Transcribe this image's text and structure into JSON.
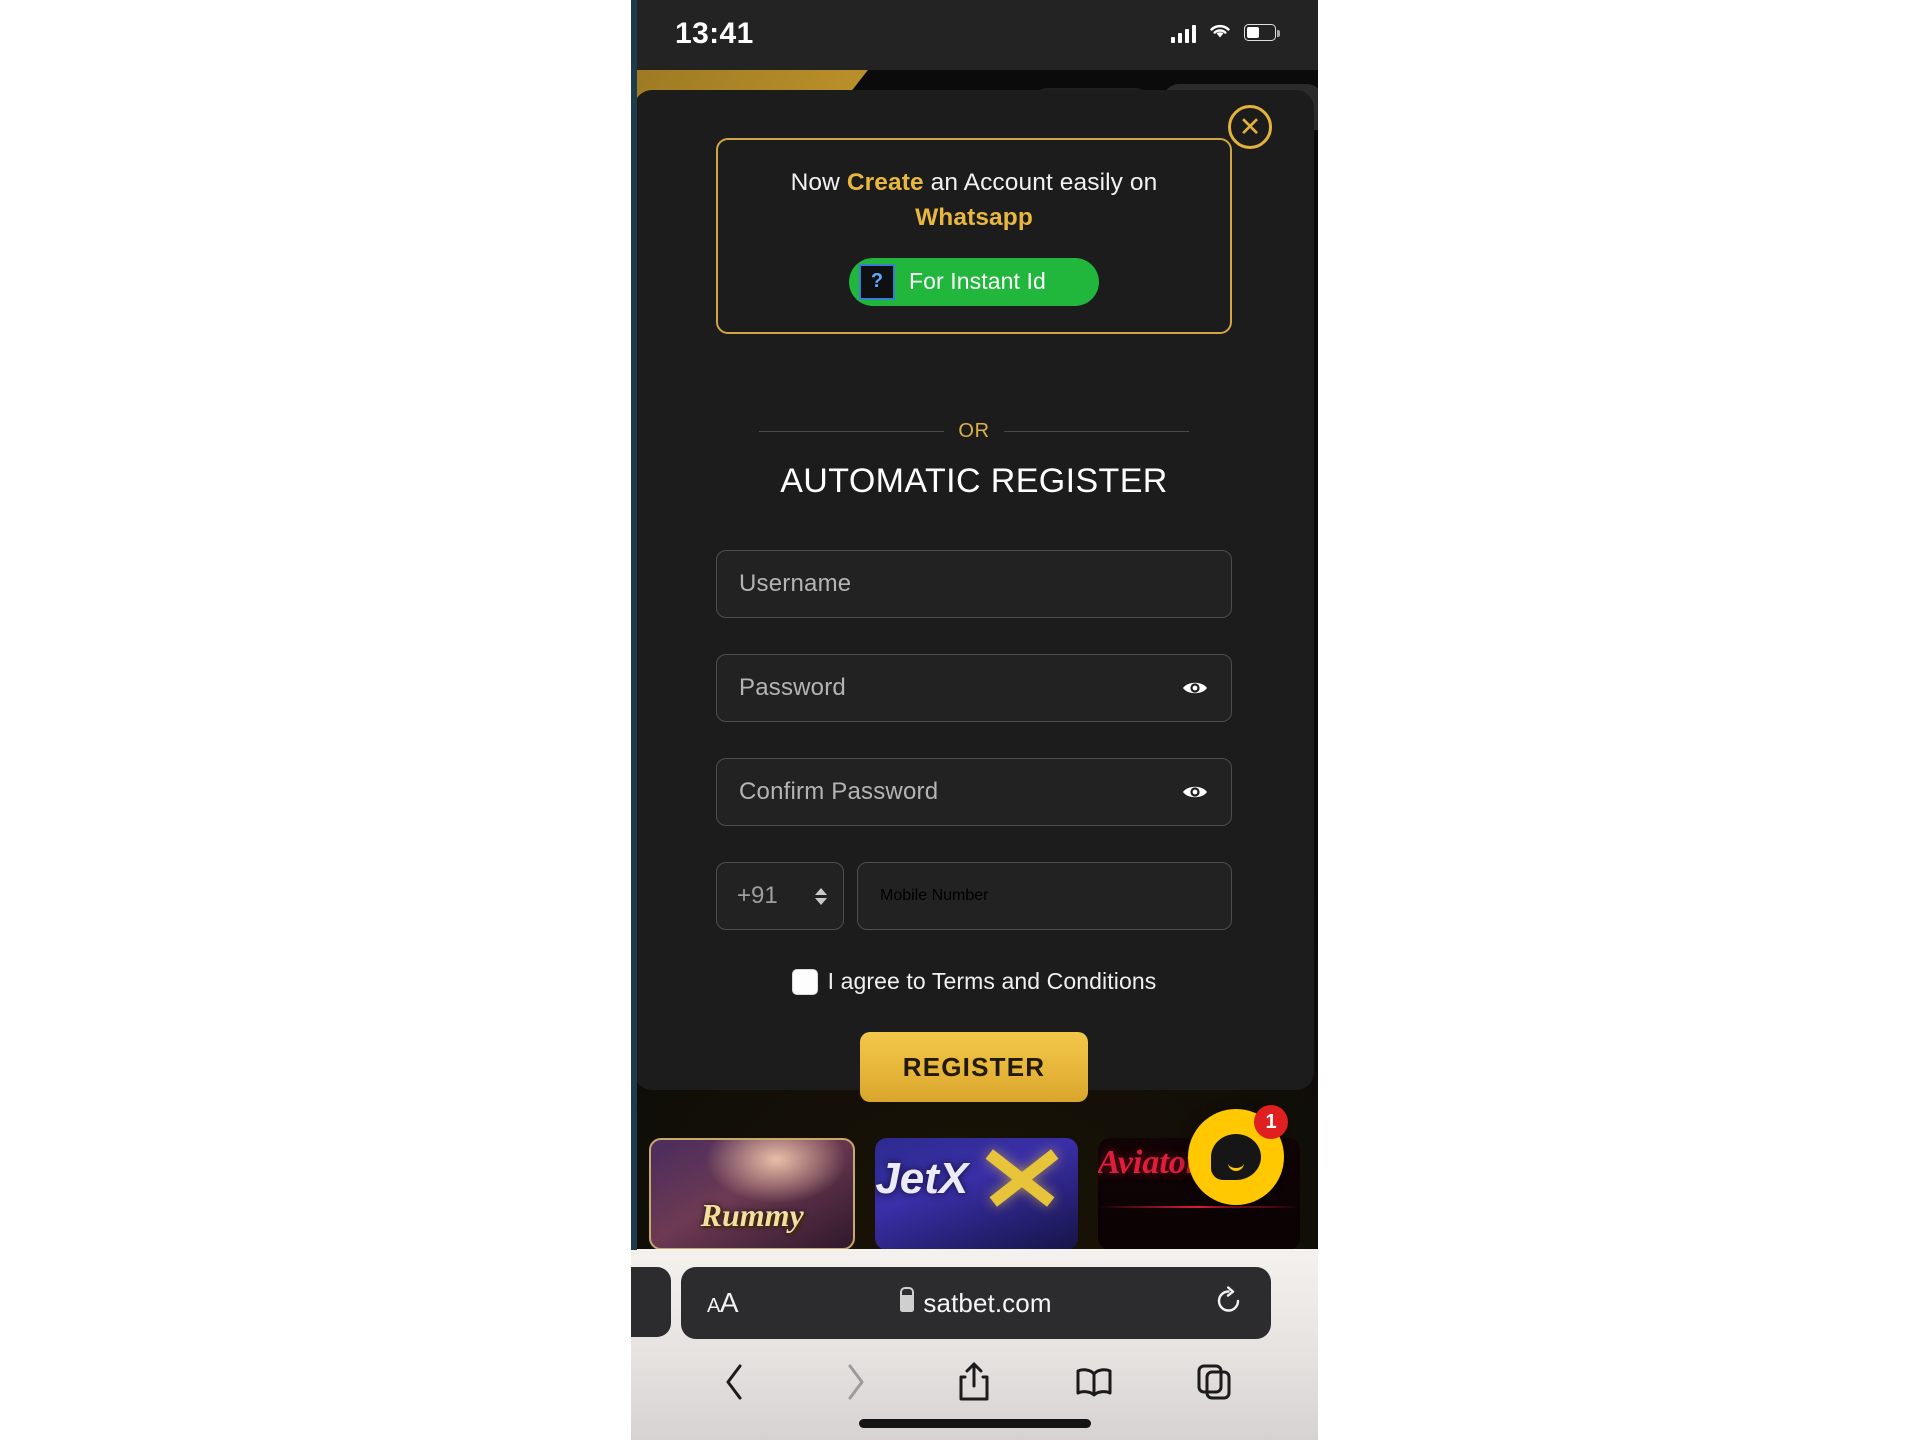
{
  "status_bar": {
    "time": "13:41",
    "signal_icon": "cellular-signal-icon",
    "wifi_icon": "wifi-icon",
    "battery_icon": "battery-icon"
  },
  "modal": {
    "close_icon": "close-icon",
    "close_label": "✕",
    "promo": {
      "line1_pre": "Now ",
      "line1_highlight": "Create",
      "line1_post": " an Account easily on",
      "line2_highlight": "Whatsapp",
      "whatsapp_button_label": "For Instant Id",
      "whatsapp_icon_glyph": "?",
      "whatsapp_icon_name": "broken-image-icon",
      "border_color": "#d1a544",
      "button_color": "#21b73c"
    },
    "divider_label": "OR",
    "heading": "AUTOMATIC REGISTER",
    "fields": {
      "username_placeholder": "Username",
      "password_placeholder": "Password",
      "confirm_password_placeholder": "Confirm Password",
      "country_code": "+91",
      "mobile_placeholder": "Mobile Number",
      "username_value": "",
      "password_value": "",
      "confirm_password_value": "",
      "mobile_value": ""
    },
    "terms_label": "I agree to Terms and Conditions",
    "terms_checked": false,
    "register_label": "REGISTER",
    "register_color": "#e8b83c"
  },
  "background": {
    "tiles": [
      {
        "label": "Rummy",
        "name": "game-tile-rummy"
      },
      {
        "label": "JetX",
        "name": "game-tile-jetx"
      },
      {
        "label": "Aviator",
        "name": "game-tile-aviator"
      }
    ],
    "chat_badge_count": "1",
    "chat_icon": "chat-bubble-icon",
    "chat_color": "#ffc800",
    "badge_color": "#e02020"
  },
  "browser": {
    "text_size_label_big": "A",
    "text_size_label_small": "A",
    "lock_icon": "lock-icon",
    "url": "satbet.com",
    "reload_icon": "reload-icon",
    "toolbar": [
      {
        "name": "back-button",
        "icon": "chevron-left-icon",
        "disabled": false
      },
      {
        "name": "forward-button",
        "icon": "chevron-right-icon",
        "disabled": true
      },
      {
        "name": "share-button",
        "icon": "share-icon",
        "disabled": false
      },
      {
        "name": "bookmarks-button",
        "icon": "book-icon",
        "disabled": false
      },
      {
        "name": "tabs-button",
        "icon": "tabs-icon",
        "disabled": false
      }
    ]
  }
}
